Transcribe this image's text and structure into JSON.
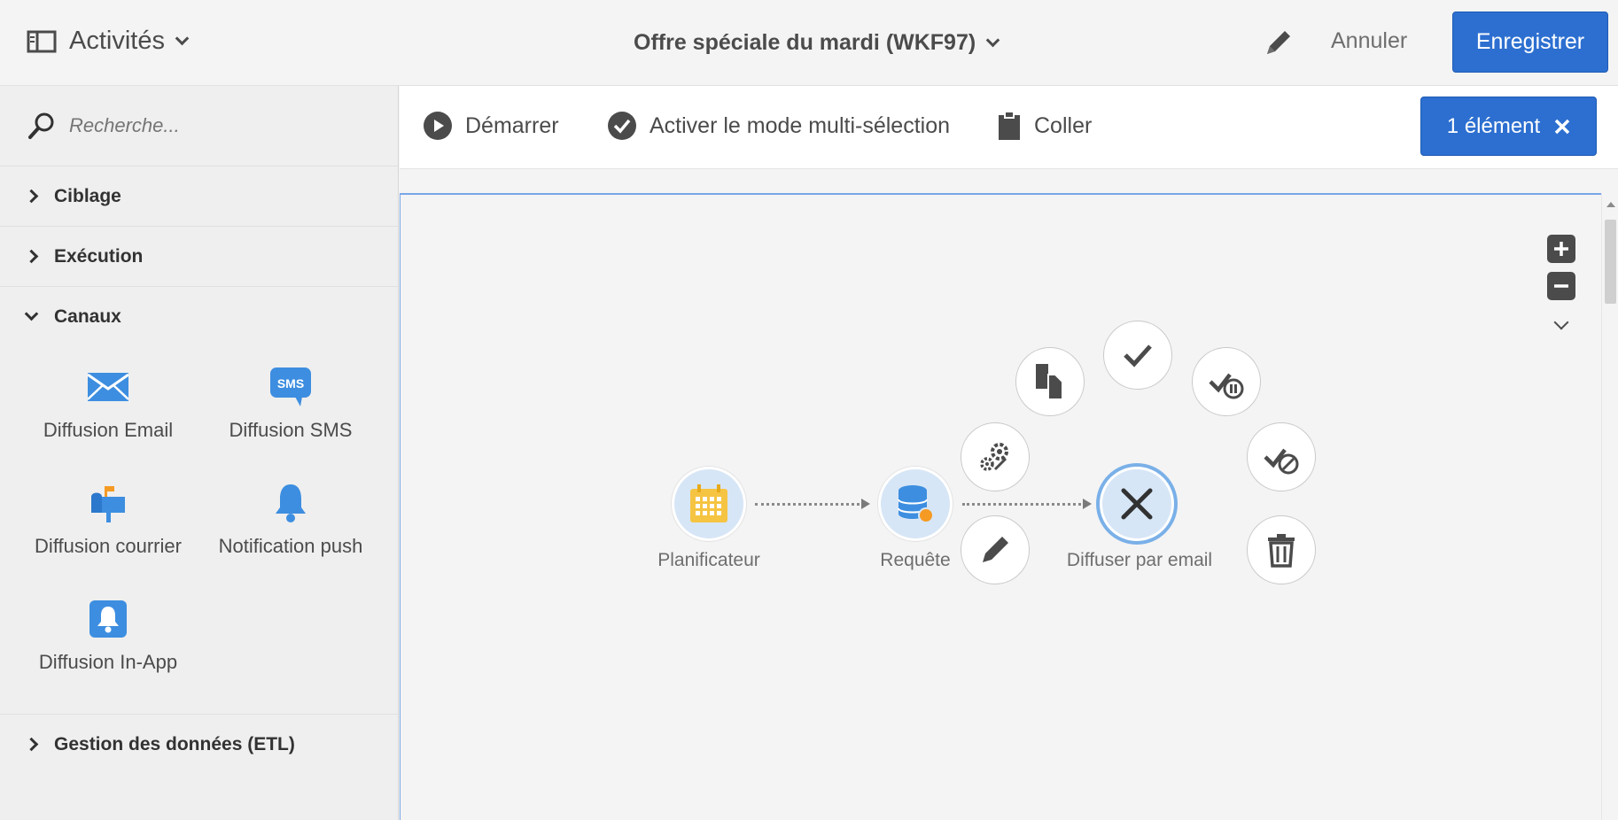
{
  "header": {
    "brand_label": "Activités",
    "workflow_title": "Offre spéciale du mardi (WKF97)",
    "cancel_label": "Annuler",
    "save_label": "Enregistrer"
  },
  "sidebar": {
    "search_placeholder": "Recherche...",
    "sections": {
      "ciblage": "Ciblage",
      "execution": "Exécution",
      "canaux": "Canaux",
      "etl": "Gestion des données (ETL)"
    },
    "channels": {
      "email": "Diffusion Email",
      "sms": "Diffusion SMS",
      "sms_icon_text": "SMS",
      "courrier": "Diffusion courrier",
      "push": "Notification push",
      "inapp": "Diffusion In-App"
    }
  },
  "toolbar": {
    "start_label": "Démarrer",
    "multiselect_label": "Activer le mode multi-sélection",
    "paste_label": "Coller",
    "selection_label": "1 élément"
  },
  "workflow": {
    "nodes": {
      "scheduler": "Planificateur",
      "query": "Requête",
      "email_delivery": "Diffuser par email"
    }
  },
  "colors": {
    "accent": "#2c6fd0",
    "node_bg": "#d7e6f6",
    "icon_blue": "#3d8ee0",
    "scheduler_yellow": "#f6c443",
    "badge_orange": "#f59a23"
  }
}
